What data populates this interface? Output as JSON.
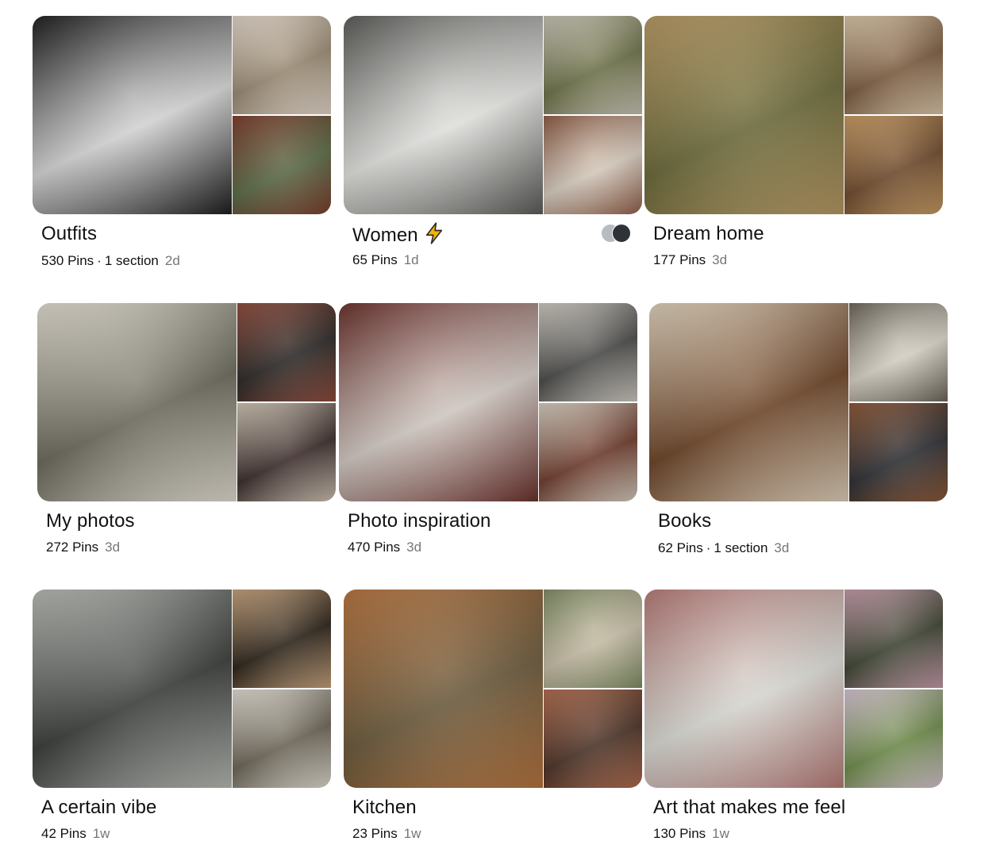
{
  "boards": [
    {
      "title": "Outfits",
      "pins": "530 Pins",
      "sections": "1 section",
      "ago": "2d",
      "colors": {
        "main": "#d9d9d9",
        "main2": "#1b1b1d",
        "tr": "#9a8a73",
        "tr2": "#e3d7cb",
        "br": "#5a6a46",
        "br2": "#7b3a2a"
      }
    },
    {
      "title": "Women",
      "pins": "65 Pins",
      "sections": "",
      "ago": "1d",
      "colors": {
        "main": "#e6e6e3",
        "main2": "#5a5a57",
        "tr": "#6d7148",
        "tr2": "#c8c4b5",
        "br": "#d8cdbf",
        "br2": "#8c5a43"
      }
    },
    {
      "title": "Dream home",
      "pins": "177 Pins",
      "sections": "",
      "ago": "3d",
      "colors": {
        "main": "#6c6a3a",
        "main2": "#b99a63",
        "tr": "#7b5a3e",
        "tr2": "#d9c7a8",
        "br": "#6e4a2c",
        "br2": "#c79a61"
      }
    },
    {
      "title": "My photos",
      "pins": "272 Pins",
      "sections": "",
      "ago": "3d",
      "colors": {
        "main": "#6c6a5c",
        "main2": "#e4dfd3",
        "tr": "#2a2826",
        "tr2": "#8e4a3a",
        "br": "#3a2b2a",
        "br2": "#d1c5b4"
      }
    },
    {
      "title": "Photo inspiration",
      "pins": "470 Pins",
      "sections": "",
      "ago": "3d",
      "colors": {
        "main": "#d5ccc6",
        "main2": "#6a2f2a",
        "tr": "#4a4a48",
        "tr2": "#cfcac2",
        "br": "#6e3b2c",
        "br2": "#d6cfc2"
      }
    },
    {
      "title": "Books",
      "pins": "62 Pins",
      "sections": "1 section",
      "ago": "3d",
      "colors": {
        "main": "#6d4427",
        "main2": "#e1d3bd",
        "tr": "#d9d4c8",
        "tr2": "#6a6358",
        "br": "#2c2e33",
        "br2": "#8c5533"
      }
    },
    {
      "title": "A certain vibe",
      "pins": "42 Pins",
      "sections": "",
      "ago": "1w",
      "colors": {
        "main": "#3a3c3a",
        "main2": "#b9bcb6",
        "tr": "#2b2218",
        "tr2": "#c7a27a",
        "br": "#6b6456",
        "br2": "#e2ddd2"
      }
    },
    {
      "title": "Kitchen",
      "pins": "23 Pins",
      "sections": "",
      "ago": "1w",
      "colors": {
        "main": "#6b5a3c",
        "main2": "#b8743e",
        "tr": "#c9bfa8",
        "tr2": "#7e8b62",
        "br": "#4a3226",
        "br2": "#b06a4c"
      }
    },
    {
      "title": "Art that makes me feel",
      "pins": "130 Pins",
      "sections": "",
      "ago": "1w",
      "colors": {
        "main": "#dcdcd6",
        "main2": "#b67a76",
        "tr": "#3d4432",
        "tr2": "#c59aa8",
        "br": "#6e8b4a",
        "br2": "#d7c4d3"
      }
    }
  ],
  "icons": {
    "bolt": "lightning-icon",
    "collaborators": "collaborator-avatars"
  }
}
